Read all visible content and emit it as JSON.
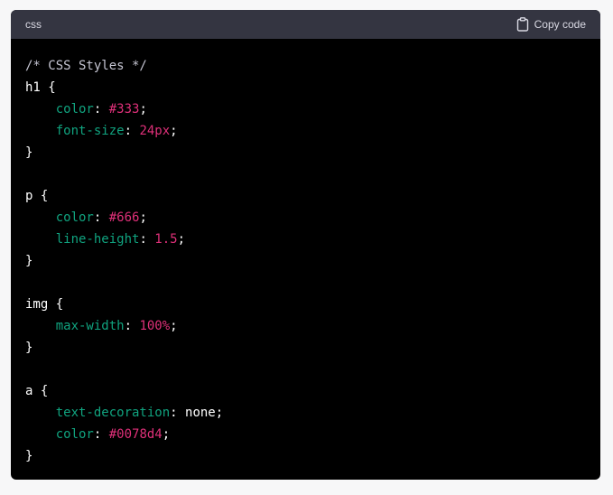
{
  "header": {
    "language": "css",
    "copy_label": "Copy code"
  },
  "code": {
    "comment": "/* CSS Styles */",
    "rules": [
      {
        "selector": "h1",
        "declarations": [
          {
            "prop": "color",
            "value": "#333",
            "value_kind": "string"
          },
          {
            "prop": "font-size",
            "value": "24px",
            "value_kind": "string"
          }
        ]
      },
      {
        "selector": "p",
        "declarations": [
          {
            "prop": "color",
            "value": "#666",
            "value_kind": "string"
          },
          {
            "prop": "line-height",
            "value": "1.5",
            "value_kind": "string"
          }
        ]
      },
      {
        "selector": "img",
        "declarations": [
          {
            "prop": "max-width",
            "value": "100%",
            "value_kind": "string"
          }
        ]
      },
      {
        "selector": "a",
        "declarations": [
          {
            "prop": "text-decoration",
            "value": "none",
            "value_kind": "keyword"
          },
          {
            "prop": "color",
            "value": "#0078d4",
            "value_kind": "string"
          }
        ]
      }
    ]
  },
  "colors": {
    "header_bg": "#343541",
    "code_bg": "#000000",
    "property": "#10a37f",
    "value": "#df3079",
    "comment": "#c5c5d2"
  },
  "icons": {
    "copy": "clipboard-icon"
  }
}
